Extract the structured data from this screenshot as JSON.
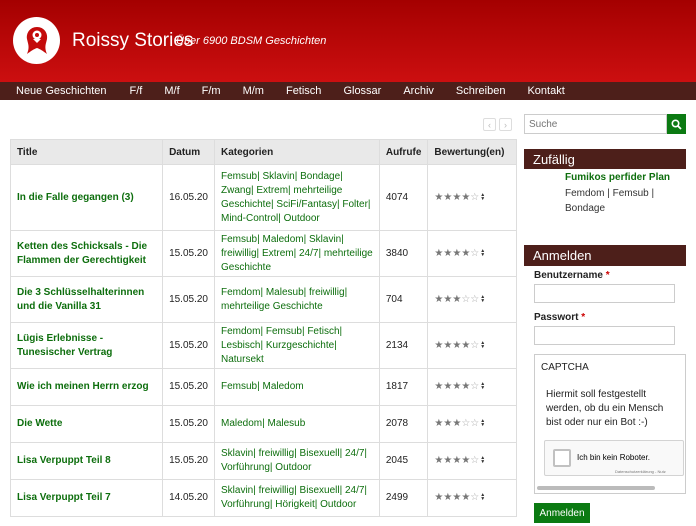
{
  "site": {
    "title": "Roissy Stories",
    "tagline": "Über 6900 BDSM Geschichten"
  },
  "nav": [
    "Neue Geschichten",
    "F/f",
    "M/f",
    "F/m",
    "M/m",
    "Fetisch",
    "Glossar",
    "Archiv",
    "Schreiben",
    "Kontakt"
  ],
  "pager": {
    "prev": "‹",
    "next": "›"
  },
  "table": {
    "headers": [
      "Title",
      "Datum",
      "Kategorien",
      "Aufrufe",
      "Bewertung(en)"
    ],
    "rows": [
      {
        "title": "In die Falle gegangen (3)",
        "date": "16.05.20",
        "cats": "Femsub| Sklavin| Bondage| Zwang| Extrem| mehrteilige Geschichte| SciFi/Fantasy| Folter| Mind-Control| Outdoor",
        "views": "4074",
        "rating": 4
      },
      {
        "title": "Ketten des Schicksals - Die Flammen der Gerechtigkeit",
        "date": "15.05.20",
        "cats": "Femsub| Maledom| Sklavin| freiwillig| Extrem| 24/7| mehrteilige Geschichte",
        "views": "3840",
        "rating": 4
      },
      {
        "title": "Die 3 Schlüsselhalterinnen und die Vanilla 31",
        "date": "15.05.20",
        "cats": "Femdom| Malesub| freiwillig| mehrteilige Geschichte",
        "views": "704",
        "rating": 3
      },
      {
        "title": "Lügis Erlebnisse - Tunesischer Vertrag",
        "date": "15.05.20",
        "cats": "Femdom| Femsub| Fetisch| Lesbisch| Kurzgeschichte| Natursekt",
        "views": "2134",
        "rating": 4
      },
      {
        "title": "Wie ich meinen Herrn erzog",
        "date": "15.05.20",
        "cats": "Femsub| Maledom",
        "views": "1817",
        "rating": 4
      },
      {
        "title": "Die Wette",
        "date": "15.05.20",
        "cats": "Maledom| Malesub",
        "views": "2078",
        "rating": 3
      },
      {
        "title": "Lisa Verpuppt Teil 8",
        "date": "15.05.20",
        "cats": "Sklavin| freiwillig| Bisexuell| 24/7| Vorführung| Outdoor",
        "views": "2045",
        "rating": 4
      },
      {
        "title": "Lisa Verpuppt Teil 7",
        "date": "14.05.20",
        "cats": "Sklavin| freiwillig| Bisexuell| 24/7| Vorführung| Hörigkeit| Outdoor",
        "views": "2499",
        "rating": 4
      }
    ]
  },
  "search": {
    "placeholder": "Suche"
  },
  "random": {
    "heading": "Zufällig",
    "title": "Fumikos perfider Plan",
    "cats": "Femdom | Femsub | Bondage"
  },
  "login": {
    "heading": "Anmelden",
    "user_label": "Benutzername",
    "pass_label": "Passwort",
    "required": "*",
    "captcha_title": "CAPTCHA",
    "captcha_desc": "Hiermit soll festgestellt werden, ob du ein Mensch bist oder nur ein Bot :-)",
    "recaptcha_label": "Ich bin kein Roboter.",
    "recaptcha_small": "Datenschutzerklärung - Nutz",
    "button": "Anmelden"
  },
  "colors": {
    "header": "#b50707",
    "nav": "#4d1f1a",
    "link": "#0d6e0d",
    "button": "#0b7a12"
  }
}
